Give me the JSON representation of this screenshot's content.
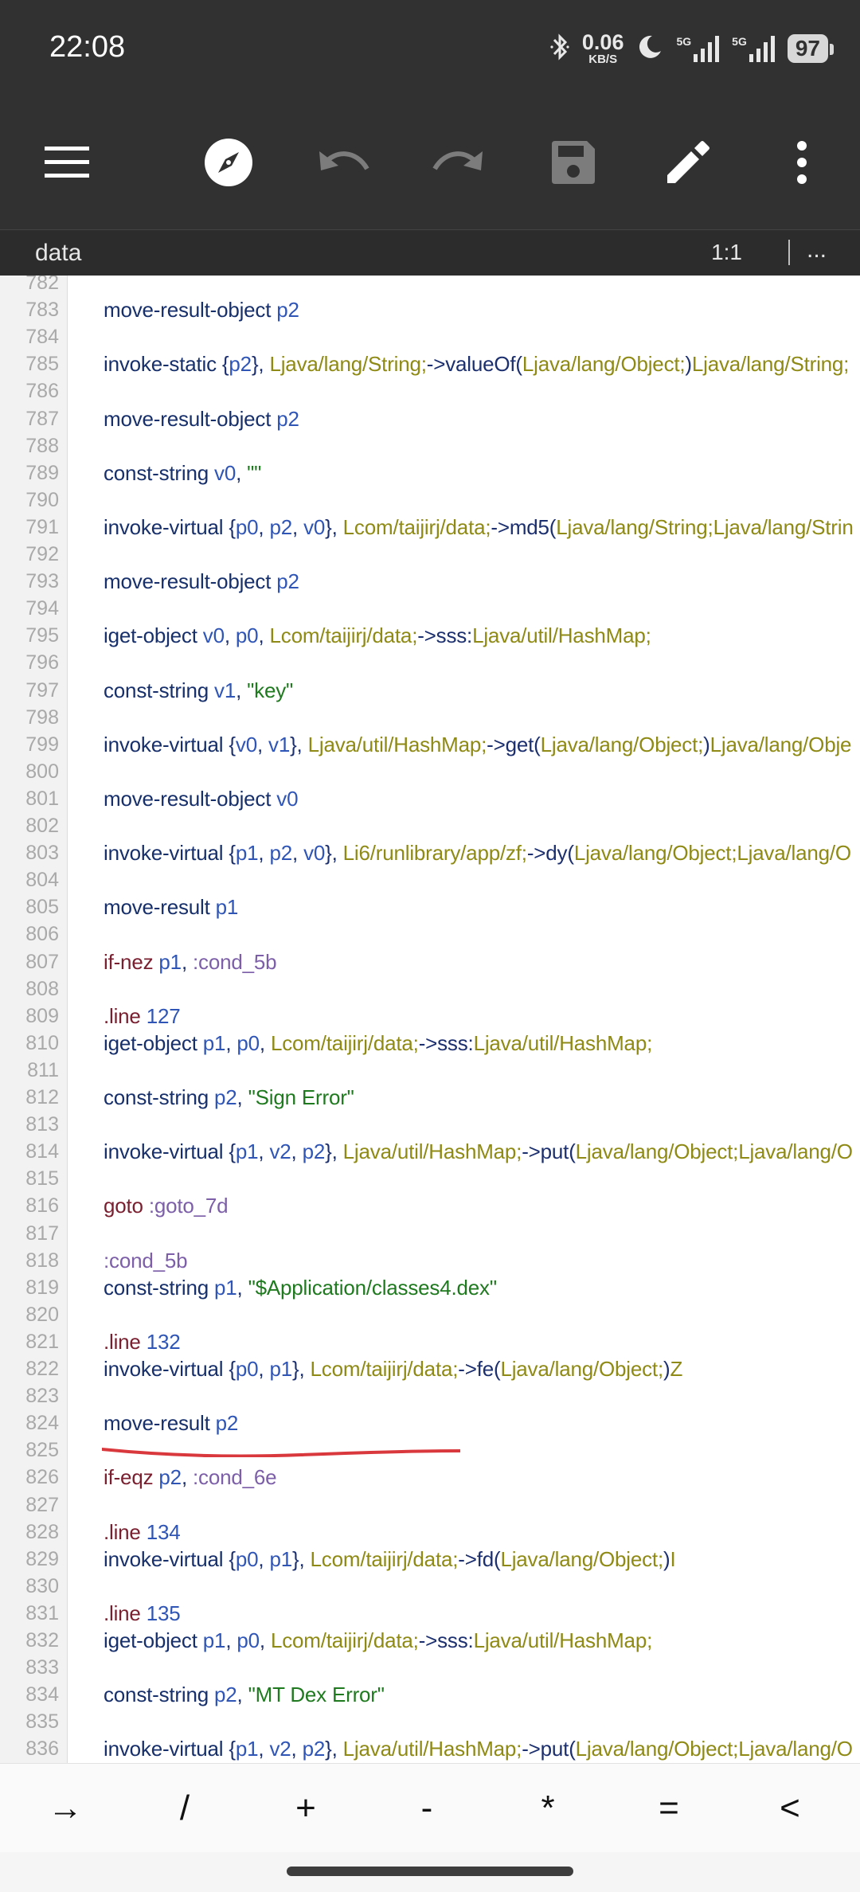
{
  "status": {
    "time": "22:08",
    "net_speed": "0.06",
    "net_unit": "KB/S",
    "signal1": "5G",
    "signal2": "5G",
    "battery": "97"
  },
  "toolbar": {
    "icons": [
      "menu-icon",
      "compass-icon",
      "undo-icon",
      "redo-icon",
      "save-icon",
      "edit-icon",
      "more-vert-icon"
    ]
  },
  "file": {
    "name": "data",
    "position": "1:1",
    "more": "..."
  },
  "colors": {
    "toolbar_bg": "#313131",
    "keyword": "#17306b",
    "register": "#2f55b6",
    "class_ref": "#8e8a15",
    "string": "#1f7a1f",
    "label": "#7c5fa8",
    "annotation_underline": "#d9383c"
  },
  "editor": {
    "lines": [
      {
        "n": "782",
        "tokens": []
      },
      {
        "n": "783",
        "tokens": [
          [
            "kw",
            "move-result-object "
          ],
          [
            "reg",
            "p2"
          ]
        ]
      },
      {
        "n": "784",
        "tokens": []
      },
      {
        "n": "785",
        "tokens": [
          [
            "kw",
            "invoke-static "
          ],
          [
            "sym",
            "{"
          ],
          [
            "reg",
            "p2"
          ],
          [
            "sym",
            "}, "
          ],
          [
            "cls",
            "Ljava/lang/String;"
          ],
          [
            "sym",
            "->valueOf("
          ],
          [
            "cls",
            "Ljava/lang/Object;"
          ],
          [
            "sym",
            ")"
          ],
          [
            "cls",
            "Ljava/lang/String;"
          ]
        ]
      },
      {
        "n": "786",
        "tokens": []
      },
      {
        "n": "787",
        "tokens": [
          [
            "kw",
            "move-result-object "
          ],
          [
            "reg",
            "p2"
          ]
        ]
      },
      {
        "n": "788",
        "tokens": []
      },
      {
        "n": "789",
        "tokens": [
          [
            "kw",
            "const-string "
          ],
          [
            "reg",
            "v0"
          ],
          [
            "sym",
            ", "
          ],
          [
            "str",
            "\"\""
          ]
        ]
      },
      {
        "n": "790",
        "tokens": []
      },
      {
        "n": "791",
        "tokens": [
          [
            "kw",
            "invoke-virtual "
          ],
          [
            "sym",
            "{"
          ],
          [
            "reg",
            "p0"
          ],
          [
            "sym",
            ", "
          ],
          [
            "reg",
            "p2"
          ],
          [
            "sym",
            ", "
          ],
          [
            "reg",
            "v0"
          ],
          [
            "sym",
            "}, "
          ],
          [
            "cls",
            "Lcom/taijirj/data;"
          ],
          [
            "sym",
            "->md5("
          ],
          [
            "cls",
            "Ljava/lang/String;Ljava/lang/Strin"
          ]
        ]
      },
      {
        "n": "792",
        "tokens": []
      },
      {
        "n": "793",
        "tokens": [
          [
            "kw",
            "move-result-object "
          ],
          [
            "reg",
            "p2"
          ]
        ]
      },
      {
        "n": "794",
        "tokens": []
      },
      {
        "n": "795",
        "tokens": [
          [
            "kw",
            "iget-object "
          ],
          [
            "reg",
            "v0"
          ],
          [
            "sym",
            ", "
          ],
          [
            "reg",
            "p0"
          ],
          [
            "sym",
            ", "
          ],
          [
            "cls",
            "Lcom/taijirj/data;"
          ],
          [
            "sym",
            "->sss:"
          ],
          [
            "cls",
            "Ljava/util/HashMap;"
          ]
        ]
      },
      {
        "n": "796",
        "tokens": []
      },
      {
        "n": "797",
        "tokens": [
          [
            "kw",
            "const-string "
          ],
          [
            "reg",
            "v1"
          ],
          [
            "sym",
            ", "
          ],
          [
            "str",
            "\"key\""
          ]
        ]
      },
      {
        "n": "798",
        "tokens": []
      },
      {
        "n": "799",
        "tokens": [
          [
            "kw",
            "invoke-virtual "
          ],
          [
            "sym",
            "{"
          ],
          [
            "reg",
            "v0"
          ],
          [
            "sym",
            ", "
          ],
          [
            "reg",
            "v1"
          ],
          [
            "sym",
            "}, "
          ],
          [
            "cls",
            "Ljava/util/HashMap;"
          ],
          [
            "sym",
            "->get("
          ],
          [
            "cls",
            "Ljava/lang/Object;"
          ],
          [
            "sym",
            ")"
          ],
          [
            "cls",
            "Ljava/lang/Obje"
          ]
        ]
      },
      {
        "n": "800",
        "tokens": []
      },
      {
        "n": "801",
        "tokens": [
          [
            "kw",
            "move-result-object "
          ],
          [
            "reg",
            "v0"
          ]
        ]
      },
      {
        "n": "802",
        "tokens": []
      },
      {
        "n": "803",
        "tokens": [
          [
            "kw",
            "invoke-virtual "
          ],
          [
            "sym",
            "{"
          ],
          [
            "reg",
            "p1"
          ],
          [
            "sym",
            ", "
          ],
          [
            "reg",
            "p2"
          ],
          [
            "sym",
            ", "
          ],
          [
            "reg",
            "v0"
          ],
          [
            "sym",
            "}, "
          ],
          [
            "cls",
            "Li6/runlibrary/app/zf;"
          ],
          [
            "sym",
            "->dy("
          ],
          [
            "cls",
            "Ljava/lang/Object;Ljava/lang/O"
          ]
        ]
      },
      {
        "n": "804",
        "tokens": []
      },
      {
        "n": "805",
        "tokens": [
          [
            "kw",
            "move-result "
          ],
          [
            "reg",
            "p1"
          ]
        ]
      },
      {
        "n": "806",
        "tokens": []
      },
      {
        "n": "807",
        "tokens": [
          [
            "ctl",
            "if-nez "
          ],
          [
            "reg",
            "p1"
          ],
          [
            "sym",
            ", "
          ],
          [
            "lbl",
            ":cond_5b"
          ]
        ]
      },
      {
        "n": "808",
        "tokens": []
      },
      {
        "n": "809",
        "tokens": [
          [
            "dir",
            ".line "
          ],
          [
            "num",
            "127"
          ]
        ]
      },
      {
        "n": "810",
        "tokens": [
          [
            "kw",
            "iget-object "
          ],
          [
            "reg",
            "p1"
          ],
          [
            "sym",
            ", "
          ],
          [
            "reg",
            "p0"
          ],
          [
            "sym",
            ", "
          ],
          [
            "cls",
            "Lcom/taijirj/data;"
          ],
          [
            "sym",
            "->sss:"
          ],
          [
            "cls",
            "Ljava/util/HashMap;"
          ]
        ]
      },
      {
        "n": "811",
        "tokens": []
      },
      {
        "n": "812",
        "tokens": [
          [
            "kw",
            "const-string "
          ],
          [
            "reg",
            "p2"
          ],
          [
            "sym",
            ", "
          ],
          [
            "str",
            "\"Sign Error\""
          ]
        ]
      },
      {
        "n": "813",
        "tokens": []
      },
      {
        "n": "814",
        "tokens": [
          [
            "kw",
            "invoke-virtual "
          ],
          [
            "sym",
            "{"
          ],
          [
            "reg",
            "p1"
          ],
          [
            "sym",
            ", "
          ],
          [
            "reg",
            "v2"
          ],
          [
            "sym",
            ", "
          ],
          [
            "reg",
            "p2"
          ],
          [
            "sym",
            "}, "
          ],
          [
            "cls",
            "Ljava/util/HashMap;"
          ],
          [
            "sym",
            "->put("
          ],
          [
            "cls",
            "Ljava/lang/Object;Ljava/lang/O"
          ]
        ]
      },
      {
        "n": "815",
        "tokens": []
      },
      {
        "n": "816",
        "tokens": [
          [
            "ctl",
            "goto "
          ],
          [
            "lbl",
            ":goto_7d"
          ]
        ]
      },
      {
        "n": "817",
        "tokens": []
      },
      {
        "n": "818",
        "tokens": [
          [
            "lbl",
            ":cond_5b"
          ]
        ]
      },
      {
        "n": "819",
        "tokens": [
          [
            "kw",
            "const-string "
          ],
          [
            "reg",
            "p1"
          ],
          [
            "sym",
            ", "
          ],
          [
            "str",
            "\"$Application/classes4.dex\""
          ]
        ]
      },
      {
        "n": "820",
        "tokens": []
      },
      {
        "n": "821",
        "tokens": [
          [
            "dir",
            ".line "
          ],
          [
            "num",
            "132"
          ]
        ]
      },
      {
        "n": "822",
        "tokens": [
          [
            "kw",
            "invoke-virtual "
          ],
          [
            "sym",
            "{"
          ],
          [
            "reg",
            "p0"
          ],
          [
            "sym",
            ", "
          ],
          [
            "reg",
            "p1"
          ],
          [
            "sym",
            "}, "
          ],
          [
            "cls",
            "Lcom/taijirj/data;"
          ],
          [
            "sym",
            "->fe("
          ],
          [
            "cls",
            "Ljava/lang/Object;"
          ],
          [
            "sym",
            ")"
          ],
          [
            "cls",
            "Z"
          ]
        ]
      },
      {
        "n": "823",
        "tokens": []
      },
      {
        "n": "824",
        "tokens": [
          [
            "kw",
            "move-result "
          ],
          [
            "reg",
            "p2"
          ]
        ]
      },
      {
        "n": "825",
        "tokens": []
      },
      {
        "n": "826",
        "tokens": [
          [
            "ctl",
            "if-eqz "
          ],
          [
            "reg",
            "p2"
          ],
          [
            "sym",
            ", "
          ],
          [
            "lbl",
            ":cond_6e"
          ]
        ]
      },
      {
        "n": "827",
        "tokens": []
      },
      {
        "n": "828",
        "tokens": [
          [
            "dir",
            ".line "
          ],
          [
            "num",
            "134"
          ]
        ]
      },
      {
        "n": "829",
        "tokens": [
          [
            "kw",
            "invoke-virtual "
          ],
          [
            "sym",
            "{"
          ],
          [
            "reg",
            "p0"
          ],
          [
            "sym",
            ", "
          ],
          [
            "reg",
            "p1"
          ],
          [
            "sym",
            "}, "
          ],
          [
            "cls",
            "Lcom/taijirj/data;"
          ],
          [
            "sym",
            "->fd("
          ],
          [
            "cls",
            "Ljava/lang/Object;"
          ],
          [
            "sym",
            ")"
          ],
          [
            "cls",
            "I"
          ]
        ]
      },
      {
        "n": "830",
        "tokens": []
      },
      {
        "n": "831",
        "tokens": [
          [
            "dir",
            ".line "
          ],
          [
            "num",
            "135"
          ]
        ]
      },
      {
        "n": "832",
        "tokens": [
          [
            "kw",
            "iget-object "
          ],
          [
            "reg",
            "p1"
          ],
          [
            "sym",
            ", "
          ],
          [
            "reg",
            "p0"
          ],
          [
            "sym",
            ", "
          ],
          [
            "cls",
            "Lcom/taijirj/data;"
          ],
          [
            "sym",
            "->sss:"
          ],
          [
            "cls",
            "Ljava/util/HashMap;"
          ]
        ]
      },
      {
        "n": "833",
        "tokens": []
      },
      {
        "n": "834",
        "tokens": [
          [
            "kw",
            "const-string "
          ],
          [
            "reg",
            "p2"
          ],
          [
            "sym",
            ", "
          ],
          [
            "str",
            "\"MT Dex Error\""
          ]
        ]
      },
      {
        "n": "835",
        "tokens": []
      },
      {
        "n": "836",
        "tokens": [
          [
            "kw",
            "invoke-virtual "
          ],
          [
            "sym",
            "{"
          ],
          [
            "reg",
            "p1"
          ],
          [
            "sym",
            ", "
          ],
          [
            "reg",
            "v2"
          ],
          [
            "sym",
            ", "
          ],
          [
            "reg",
            "p2"
          ],
          [
            "sym",
            "}, "
          ],
          [
            "cls",
            "Ljava/util/HashMap;"
          ],
          [
            "sym",
            "->put("
          ],
          [
            "cls",
            "Ljava/lang/Object;Ljava/lang/O"
          ]
        ]
      }
    ]
  },
  "symbols": [
    "→",
    "/",
    "+",
    "-",
    "*",
    "=",
    "<"
  ]
}
